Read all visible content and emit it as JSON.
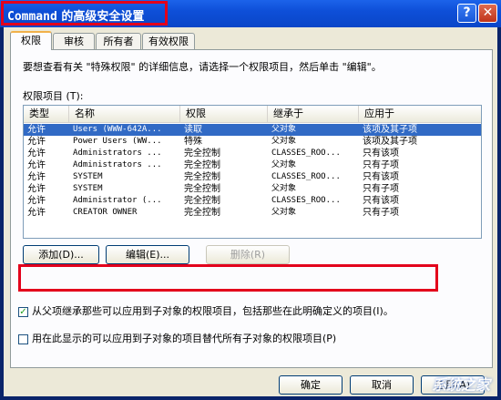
{
  "window": {
    "title_mono": "Command",
    "title_rest": " 的高级安全设置",
    "help_label": "?",
    "close_label": "✕"
  },
  "tabs": [
    {
      "label": "权限"
    },
    {
      "label": "审核"
    },
    {
      "label": "所有者"
    },
    {
      "label": "有效权限"
    }
  ],
  "panel": {
    "description": "要想查看有关 \"特殊权限\" 的详细信息，请选择一个权限项目，然后单击 \"编辑\"。",
    "list_label": "权限项目 (T):"
  },
  "table": {
    "columns": [
      "类型",
      "名称",
      "权限",
      "继承于",
      "应用于"
    ],
    "rows": [
      {
        "type": "允许",
        "name": "Users (WWW-642A...",
        "perm": "读取",
        "inherit": "父对象",
        "apply": "该项及其子项",
        "selected": true
      },
      {
        "type": "允许",
        "name": "Power Users (WW...",
        "perm": "特殊",
        "inherit": "父对象",
        "apply": "该项及其子项",
        "selected": false
      },
      {
        "type": "允许",
        "name": "Administrators ...",
        "perm": "完全控制",
        "inherit": "CLASSES_ROO...",
        "apply": "只有该项",
        "selected": false
      },
      {
        "type": "允许",
        "name": "Administrators ...",
        "perm": "完全控制",
        "inherit": "父对象",
        "apply": "只有子项",
        "selected": false
      },
      {
        "type": "允许",
        "name": "SYSTEM",
        "perm": "完全控制",
        "inherit": "CLASSES_ROO...",
        "apply": "只有该项",
        "selected": false
      },
      {
        "type": "允许",
        "name": "SYSTEM",
        "perm": "完全控制",
        "inherit": "父对象",
        "apply": "只有子项",
        "selected": false
      },
      {
        "type": "允许",
        "name": "Administrator (...",
        "perm": "完全控制",
        "inherit": "CLASSES_ROO...",
        "apply": "只有该项",
        "selected": false
      },
      {
        "type": "允许",
        "name": "CREATOR OWNER",
        "perm": "完全控制",
        "inherit": "父对象",
        "apply": "只有子项",
        "selected": false
      }
    ]
  },
  "buttons": {
    "add": "添加(D)...",
    "edit": "编辑(E)...",
    "delete": "删除(R)"
  },
  "options": {
    "inherit_label": "从父项继承那些可以应用到子对象的权限项目，包括那些在此明确定义的项目(I)。",
    "inherit_checked": "✓",
    "replace_label": "用在此显示的可以应用到子对象的项目替代所有子对象的权限项目(P)",
    "replace_checked": ""
  },
  "footer": {
    "ok": "确定",
    "cancel": "取消",
    "apply": "应用(A)"
  },
  "watermark": "系统之家",
  "colors": {
    "highlight_red": "#e3001b",
    "selection_blue": "#316ac5"
  }
}
